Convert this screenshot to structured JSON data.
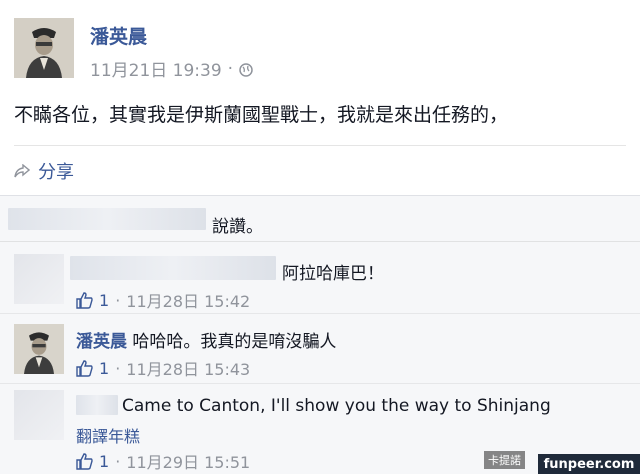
{
  "post": {
    "author": "潘英晨",
    "timestamp": "11月21日 19:39",
    "separator": "·",
    "privacy_icon": "globe-icon",
    "text": "不瞞各位，其實我是伊斯蘭國聖戰士，我就是來出任務的，",
    "share_label": "分享",
    "share_icon": "share-icon"
  },
  "likes": {
    "text": "說讚。"
  },
  "comments": [
    {
      "text": "阿拉哈庫巴！",
      "likes": "1",
      "timestamp": "11月28日 15:42",
      "separator": "·"
    },
    {
      "author": "潘英晨",
      "text": "哈哈哈。我真的是唷沒騙人",
      "likes": "1",
      "timestamp": "11月28日 15:43",
      "separator": "·"
    },
    {
      "text": "Came to Canton, I'll show you the way to Shinjang",
      "translate_label": "翻譯年糕",
      "likes": "1",
      "timestamp": "11月29日 15:51",
      "separator": "·"
    }
  ],
  "watermark": {
    "left_text": "卡提諾",
    "right_text": "funpeer.com"
  },
  "colors": {
    "link": "#3b5998",
    "meta": "#90949c",
    "panel": "#f6f7f9"
  }
}
